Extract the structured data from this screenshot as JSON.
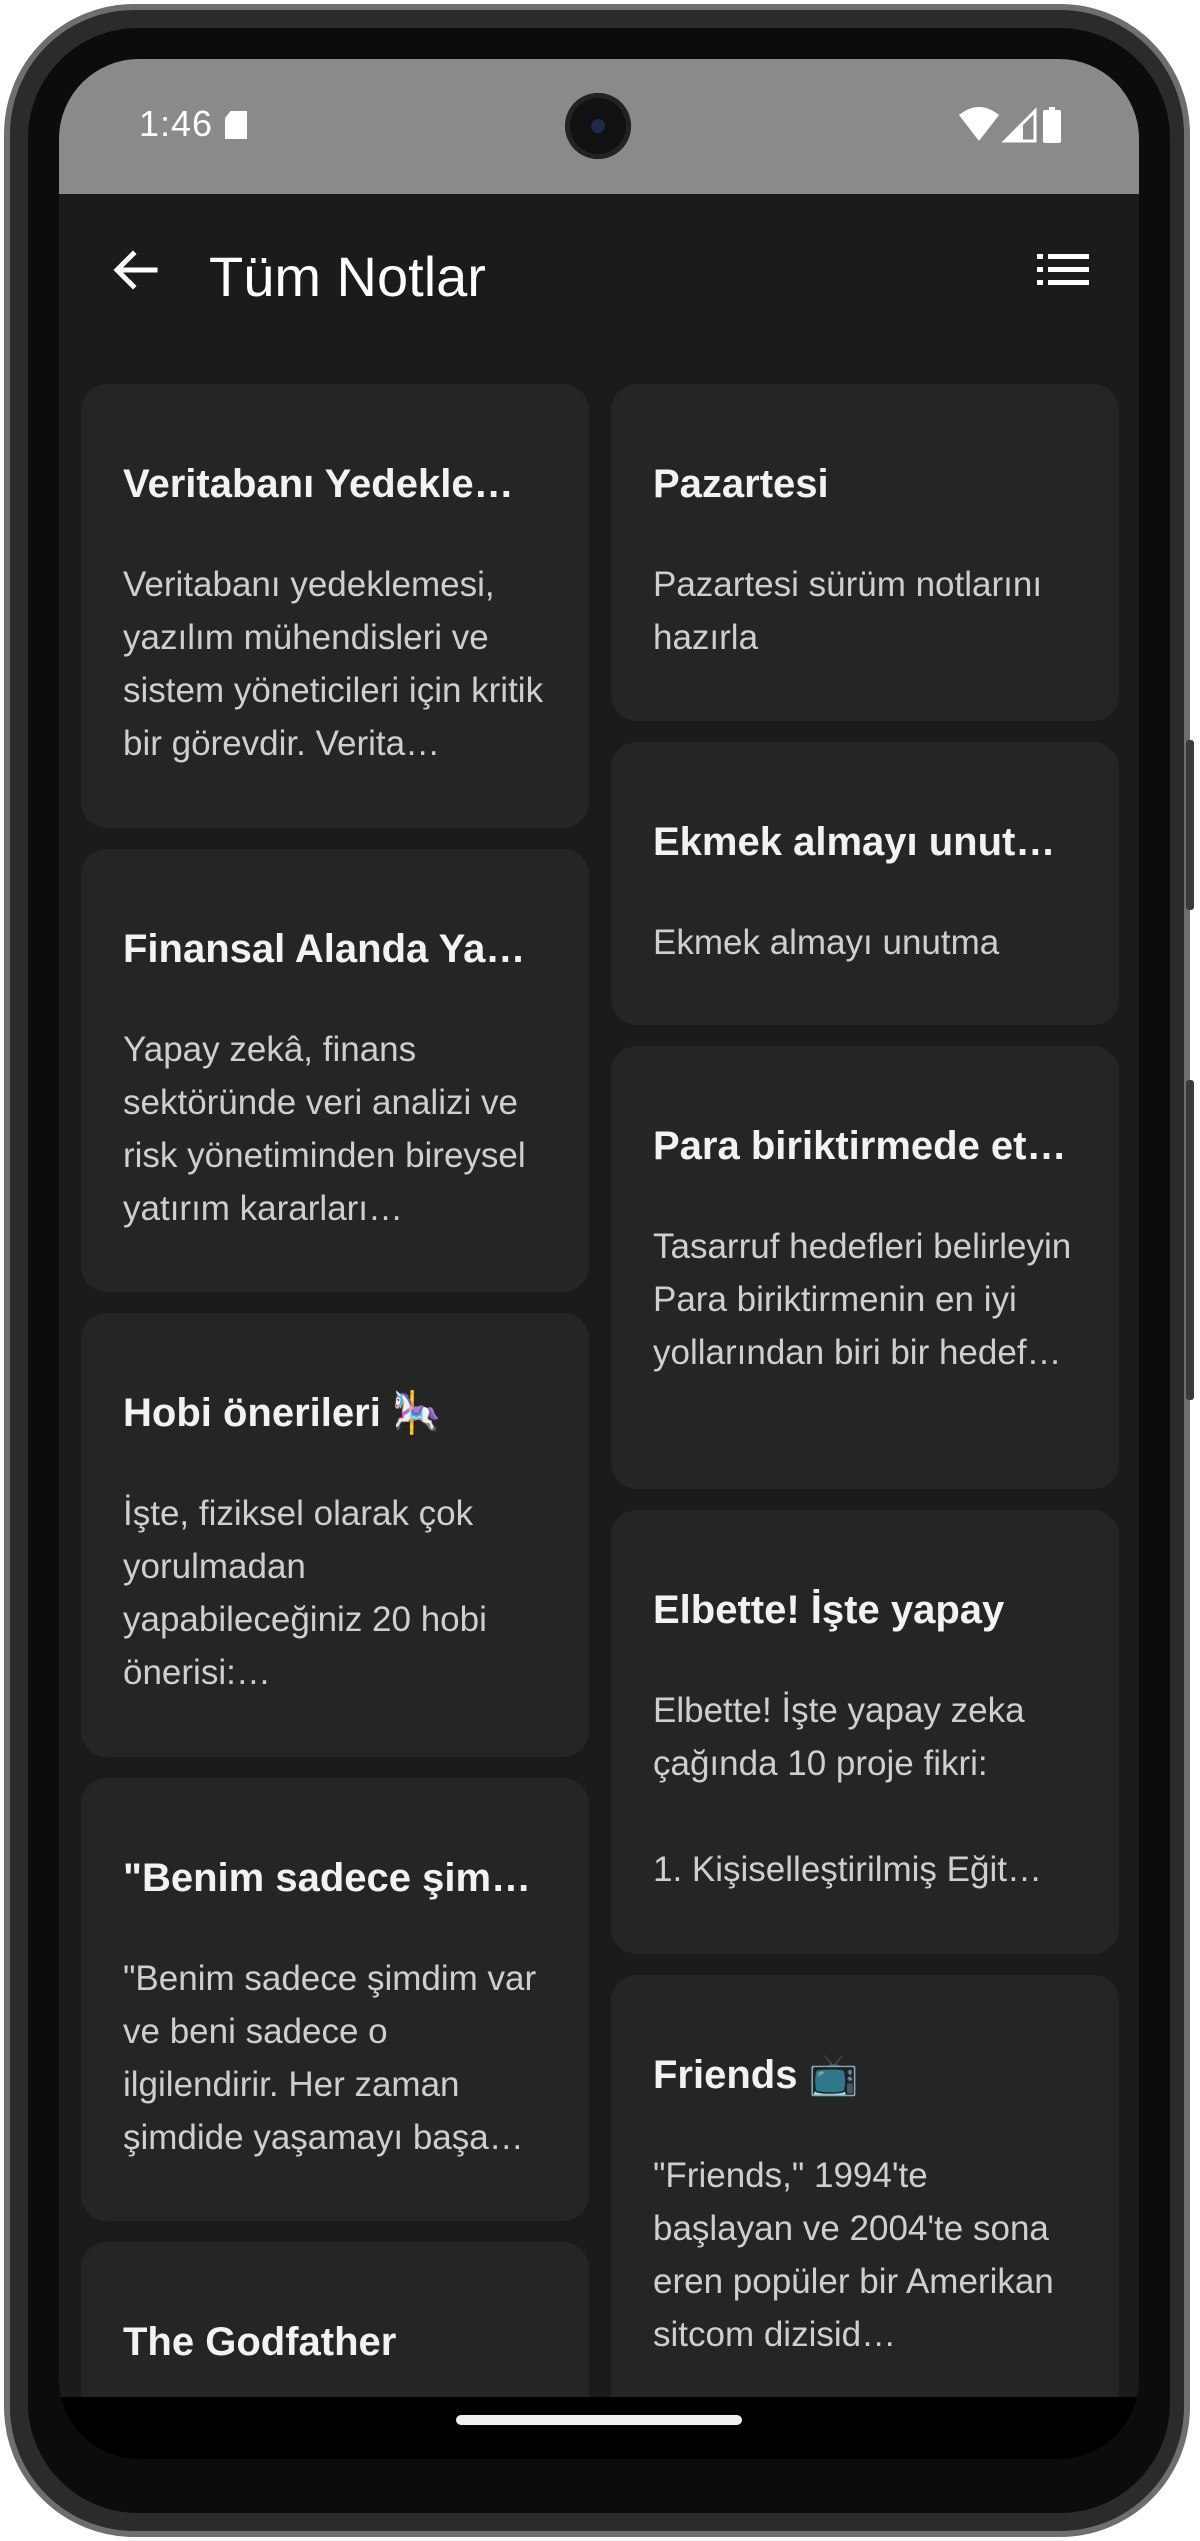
{
  "status_bar": {
    "time": "1:46",
    "icons": [
      "sd-card-icon",
      "wifi-icon",
      "signal-icon",
      "battery-icon"
    ]
  },
  "app_bar": {
    "title": "Tüm Notlar",
    "back_icon": "arrow-back-icon",
    "view_icon": "list-view-icon"
  },
  "notes": {
    "left": [
      {
        "title": "Veritabanı Yedekle…",
        "body": "Veritabanı yedeklemesi, yazılım mühendisleri ve sistem yöneticileri için kritik bir görevdir. Verita…"
      },
      {
        "title": "Finansal Alanda Yap…",
        "body": "Yapay zekâ, finans sektöründe veri analizi ve risk yönetiminden bireysel yatırım kararları…"
      },
      {
        "title": "Hobi önerileri 🎠",
        "body": "İşte, fiziksel olarak çok yorulmadan yapabileceğiniz 20 hobi önerisi:…"
      },
      {
        "title": "\"Benim sadece şimd…",
        "body": "\"Benim sadece şimdim var ve beni sadece o ilgilendirir. Her zaman şimdide yaşamayı başa…"
      },
      {
        "title": "The Godfather",
        "body": ""
      }
    ],
    "right": [
      {
        "title": "Pazartesi",
        "body": "Pazartesi sürüm notlarını hazırla"
      },
      {
        "title": "Ekmek almayı unut…",
        "body": "Ekmek almayı unutma"
      },
      {
        "title": "Para biriktirmede et…",
        "body": "Tasarruf hedefleri belirleyin\nPara biriktirmenin en iyi yollarından biri bir hedef…"
      },
      {
        "title": "Elbette! İşte yapay",
        "body": "Elbette! İşte yapay zeka çağında 10 proje fikri:\n\n  1. Kişiselleştirilmiş Eğit…"
      },
      {
        "title": "Friends 📺",
        "body": "\"Friends,\" 1994'te başlayan ve 2004'te sona eren popüler bir Amerikan sitcom dizisid…"
      }
    ]
  },
  "colors": {
    "background": "#1b1b1b",
    "card": "#252525",
    "status_bar": "#8a8a8a",
    "title_text": "#f2f2f2",
    "body_text": "#cfcfcf"
  }
}
